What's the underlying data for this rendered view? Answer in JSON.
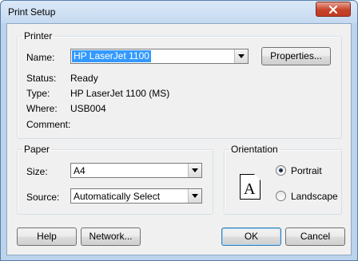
{
  "window": {
    "title": "Print Setup",
    "close_icon": "close-icon"
  },
  "printer": {
    "group_label": "Printer",
    "name_label": "Name:",
    "name_value": "HP LaserJet 1100",
    "properties_button": "Properties...",
    "status_label": "Status:",
    "status_value": "Ready",
    "type_label": "Type:",
    "type_value": "HP LaserJet 1100 (MS)",
    "where_label": "Where:",
    "where_value": "USB004",
    "comment_label": "Comment:",
    "comment_value": ""
  },
  "paper": {
    "group_label": "Paper",
    "size_label": "Size:",
    "size_value": "A4",
    "source_label": "Source:",
    "source_value": "Automatically Select"
  },
  "orientation": {
    "group_label": "Orientation",
    "page_letter": "A",
    "portrait_label": "Portrait",
    "landscape_label": "Landscape",
    "selected": "Portrait"
  },
  "buttons": {
    "help": "Help",
    "network": "Network...",
    "ok": "OK",
    "cancel": "Cancel"
  },
  "colors": {
    "selection": "#3399ff",
    "close_button": "#c7432a",
    "frame": "#bcd3ec"
  }
}
